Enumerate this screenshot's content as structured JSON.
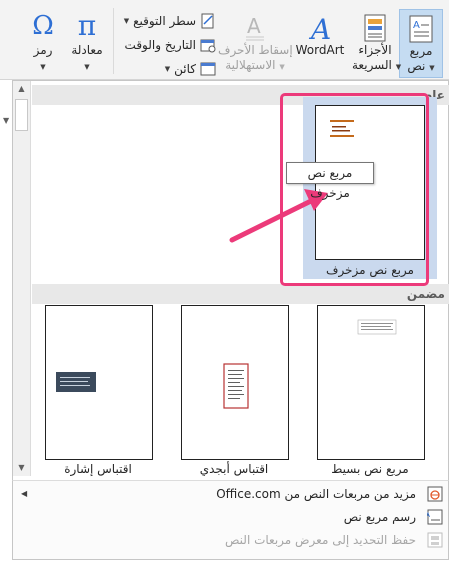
{
  "ribbon": {
    "text_box": {
      "label_line1": "مربع",
      "label_line2": "نص"
    },
    "quick_parts": {
      "label_line1": "الأجزاء",
      "label_line2": "السريعة"
    },
    "wordart": {
      "label": "WordArt"
    },
    "drop_cap": {
      "label_line1": "إسقاط الأحرف",
      "label_line2": "الاستهلالية"
    },
    "signature_line": {
      "label": "سطر التوقيع"
    },
    "date_time": {
      "label": "التاريخ والوقت"
    },
    "object": {
      "label": "كائن"
    },
    "equation": {
      "label": "معادلة"
    },
    "symbol": {
      "label": "رمز"
    }
  },
  "gallery": {
    "section_general": "عام",
    "section_builtin": "مضمن",
    "items": [
      {
        "caption": "مربع نص مزخرف"
      },
      {
        "caption": "مربع نص بسيط"
      },
      {
        "caption": "اقتباس أبجدي"
      },
      {
        "caption": "اقتباس إشارة"
      }
    ]
  },
  "tooltip": {
    "text": "مربع نص مزخرف"
  },
  "menu": {
    "more_from_office": "مزيد من مربعات النص من Office.com",
    "draw_text_box": "رسم مربع نص",
    "save_selection": "حفظ التحديد إلى معرض مربعات النص"
  },
  "colors": {
    "accent_pink": "#ec3a7a",
    "selected_blue": "#c5dcf2",
    "wordart_blue": "#2e6fd4"
  },
  "icons": [
    "text-box-icon",
    "quick-parts-icon",
    "wordart-icon",
    "drop-cap-icon",
    "signature-line-icon",
    "date-time-icon",
    "object-icon",
    "equation-icon",
    "symbol-icon"
  ]
}
